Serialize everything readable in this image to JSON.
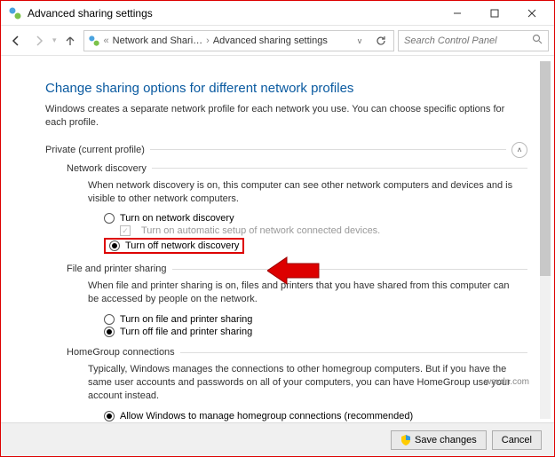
{
  "window": {
    "title": "Advanced sharing settings",
    "minimize_tip": "Minimize",
    "maximize_tip": "Maximize",
    "close_tip": "Close"
  },
  "nav": {
    "back_tip": "Back",
    "forward_tip": "Forward",
    "up_tip": "Up",
    "refresh_tip": "Refresh",
    "dropdown_tip": "Previous locations",
    "crumb1": "Network and Shari…",
    "crumb2": "Advanced sharing settings"
  },
  "search": {
    "placeholder": "Search Control Panel"
  },
  "page": {
    "title": "Change sharing options for different network profiles",
    "description": "Windows creates a separate network profile for each network you use. You can choose specific options for each profile."
  },
  "private_profile": {
    "label": "Private (current profile)"
  },
  "network_discovery": {
    "header": "Network discovery",
    "desc": "When network discovery is on, this computer can see other network computers and devices and is visible to other network computers.",
    "opt_on": "Turn on network discovery",
    "opt_auto": "Turn on automatic setup of network connected devices.",
    "opt_off": "Turn off network discovery"
  },
  "file_printer": {
    "header": "File and printer sharing",
    "desc": "When file and printer sharing is on, files and printers that you have shared from this computer can be accessed by people on the network.",
    "opt_on": "Turn on file and printer sharing",
    "opt_off": "Turn off file and printer sharing"
  },
  "homegroup": {
    "header": "HomeGroup connections",
    "desc": "Typically, Windows manages the connections to other homegroup computers. But if you have the same user accounts and passwords on all of your computers, you can have HomeGroup use your account instead.",
    "opt_allow": "Allow Windows to manage homegroup connections (recommended)"
  },
  "footer": {
    "save": "Save changes",
    "cancel": "Cancel"
  },
  "watermark": "wsxdn.com"
}
